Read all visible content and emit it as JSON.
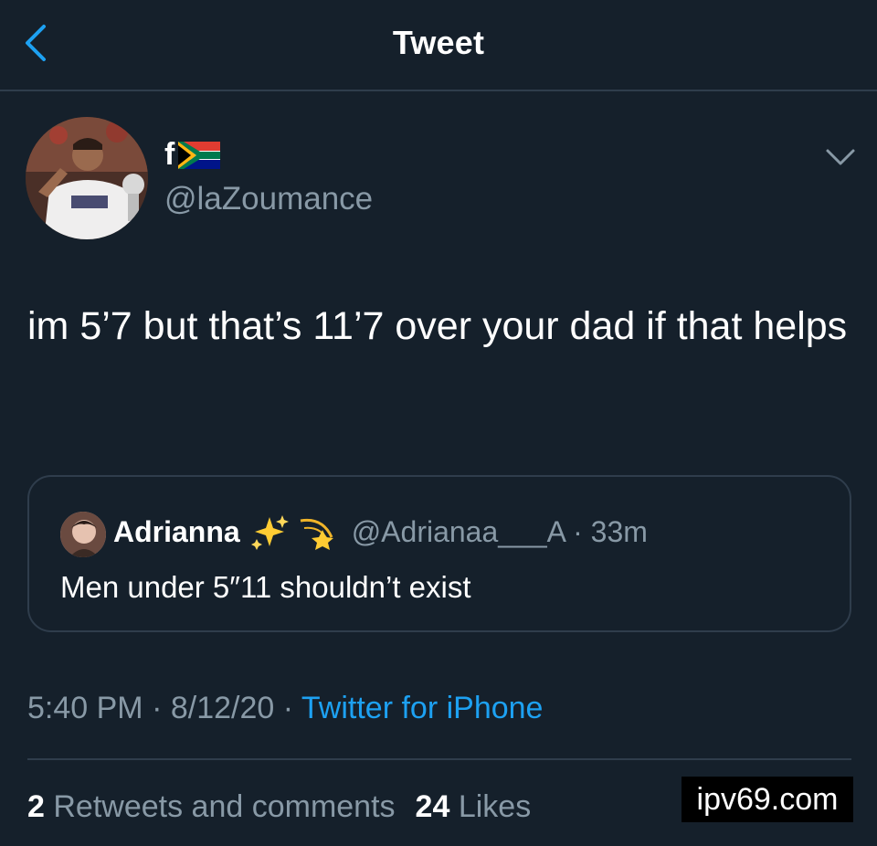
{
  "header": {
    "title": "Tweet",
    "back_icon": "chevron-left-icon"
  },
  "tweet": {
    "author": {
      "display_name": "f",
      "flag_icon": "south-africa-flag-icon",
      "handle": "@laZoumance"
    },
    "menu_icon": "chevron-down-icon",
    "text": "im 5’7 but that’s 11’7 over your dad if that helps",
    "quoted": {
      "name": "Adrianna",
      "emoji": [
        "sparkles-icon",
        "dizzy-star-icon"
      ],
      "handle_time": "@Adrianaa___A · 33m",
      "text": "Men under 5″11 shouldn’t exist"
    },
    "meta": {
      "time": "5:40 PM",
      "sep1": " · ",
      "date": "8/12/20",
      "sep2": " · ",
      "source": "Twitter for iPhone"
    },
    "stats": {
      "retweets_count": "2",
      "retweets_label": "Retweets and comments",
      "likes_count": "24",
      "likes_label": "Likes"
    }
  },
  "watermark": "ipv69.com",
  "colors": {
    "background": "#15202b",
    "border": "#2f3d4c",
    "secondary_text": "#8899a6",
    "accent": "#1da1f2"
  }
}
